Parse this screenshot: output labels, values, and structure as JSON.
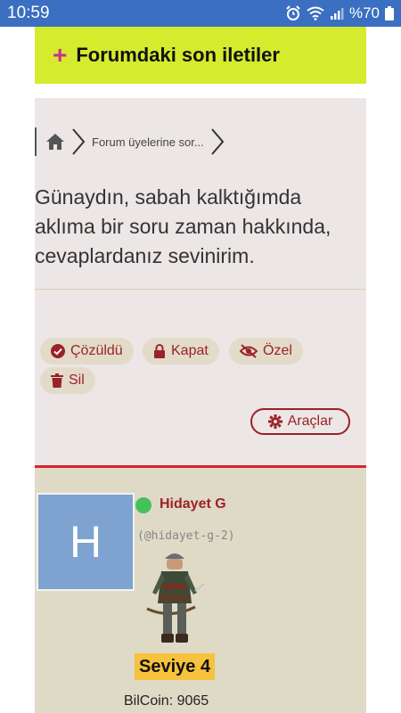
{
  "status_bar": {
    "time": "10:59",
    "battery": "%70",
    "icons": [
      "alarm-icon",
      "wifi-icon",
      "signal-icon",
      "battery-icon"
    ]
  },
  "forum_header": {
    "icon": "plus-icon",
    "title": "Forumdaki son iletiler"
  },
  "breadcrumb": {
    "home_icon": "home-icon",
    "item": "Forum üyelerine sor..."
  },
  "post": {
    "body": "Günaydın, sabah kalktığımda aklıma bir soru zaman hakkında, cevaplardanız sevinirim.",
    "actions": [
      {
        "label": "Çözüldü",
        "icon": "check-circle-icon"
      },
      {
        "label": "Kapat",
        "icon": "lock-icon"
      },
      {
        "label": "Özel",
        "icon": "eye-slash-icon"
      },
      {
        "label": "Sil",
        "icon": "trash-icon"
      }
    ],
    "tools_label": "Araçlar",
    "tools_icon": "gear-icon"
  },
  "user": {
    "avatar_letter": "H",
    "name": "Hidayet G",
    "handle": "(@hidayet-g-2)",
    "online": true,
    "level": "Seviye 4",
    "bilcoin": "BilCoin: 9065"
  },
  "colors": {
    "status_bar": "#3a6fc1",
    "header_bg": "#d4eb2e",
    "accent_red": "#9b2227",
    "post_bg": "#ece6e6",
    "user_bg": "#dedac6",
    "avatar_bg": "#7fa3d0",
    "online": "#45c15a",
    "level_bg": "#f7c23d"
  }
}
